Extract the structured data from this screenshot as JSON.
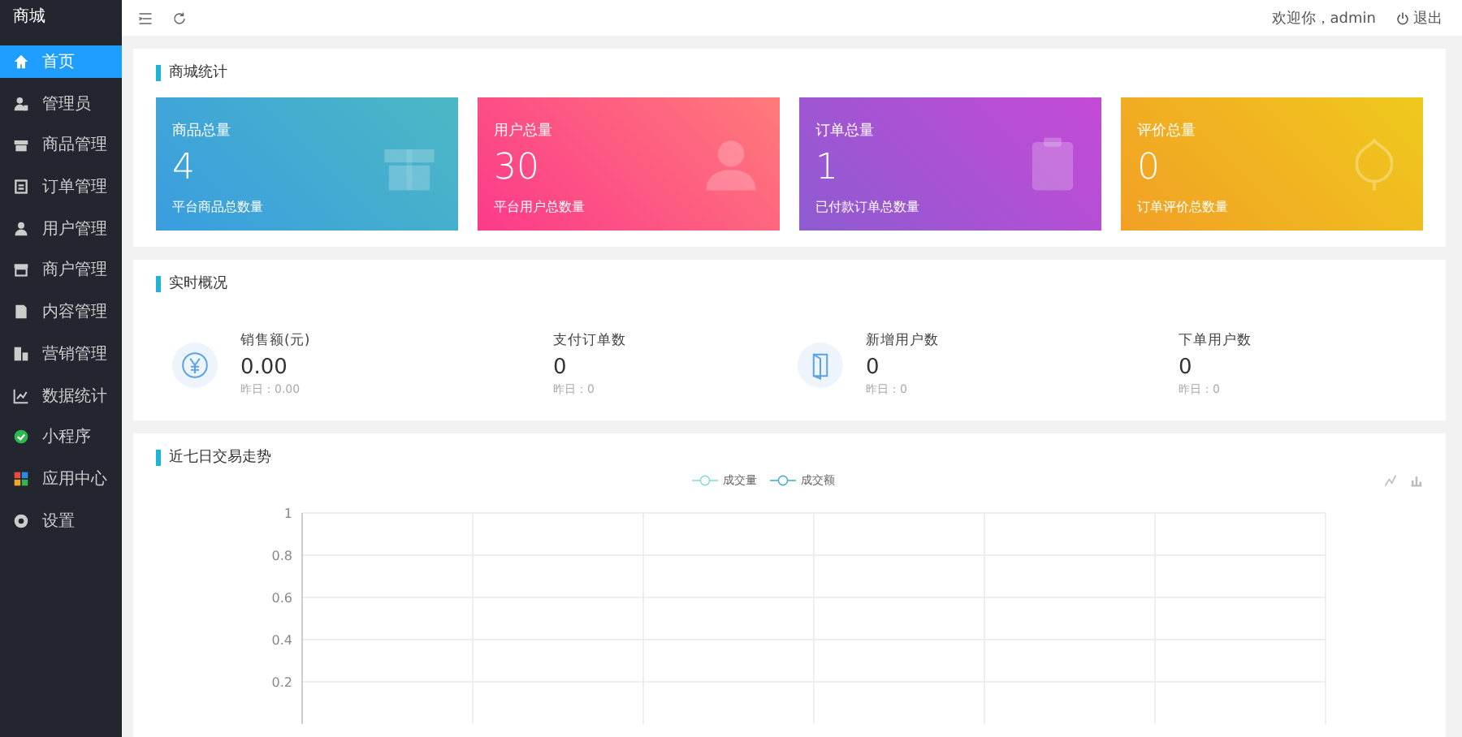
{
  "sidebar": {
    "logo": "商城",
    "items": [
      {
        "label": "首页",
        "selected": true
      },
      {
        "label": "管理员",
        "selected": false
      },
      {
        "label": "商品管理",
        "selected": false
      },
      {
        "label": "订单管理",
        "selected": false
      },
      {
        "label": "用户管理",
        "selected": false
      },
      {
        "label": "商户管理",
        "selected": false
      },
      {
        "label": "内容管理",
        "selected": false
      },
      {
        "label": "营销管理",
        "selected": false
      },
      {
        "label": "数据统计",
        "selected": false
      },
      {
        "label": "小程序",
        "selected": false
      },
      {
        "label": "应用中心",
        "selected": false
      },
      {
        "label": "设置",
        "selected": false
      }
    ]
  },
  "header": {
    "welcome": "欢迎你，admin",
    "logout": "退出"
  },
  "stats_panel": {
    "title": "商城统计",
    "cards": [
      {
        "label": "商品总量",
        "value": "4",
        "caption": "平台商品总数量"
      },
      {
        "label": "用户总量",
        "value": "30",
        "caption": "平台用户总数量"
      },
      {
        "label": "订单总量",
        "value": "1",
        "caption": "已付款订单总数量"
      },
      {
        "label": "评价总量",
        "value": "0",
        "caption": "订单评价总数量"
      }
    ]
  },
  "overview_panel": {
    "title": "实时概况",
    "metrics": [
      {
        "label": "销售额(元)",
        "value": "0.00",
        "yesterday": "昨日：0.00"
      },
      {
        "label": "支付订单数",
        "value": "0",
        "yesterday": "昨日：0"
      },
      {
        "label": "新增用户数",
        "value": "0",
        "yesterday": "昨日：0"
      },
      {
        "label": "下单用户数",
        "value": "0",
        "yesterday": "昨日：0"
      }
    ]
  },
  "trend_panel": {
    "title": "近七日交易走势",
    "chart_data": {
      "type": "line",
      "series": [
        {
          "name": "成交量",
          "color": "#8fd9d2"
        },
        {
          "name": "成交额",
          "color": "#4fb0c8"
        }
      ],
      "grid": true,
      "ylim": [
        0,
        1
      ],
      "yticks": [
        0.2,
        0.4,
        0.6,
        0.8,
        1
      ]
    }
  }
}
